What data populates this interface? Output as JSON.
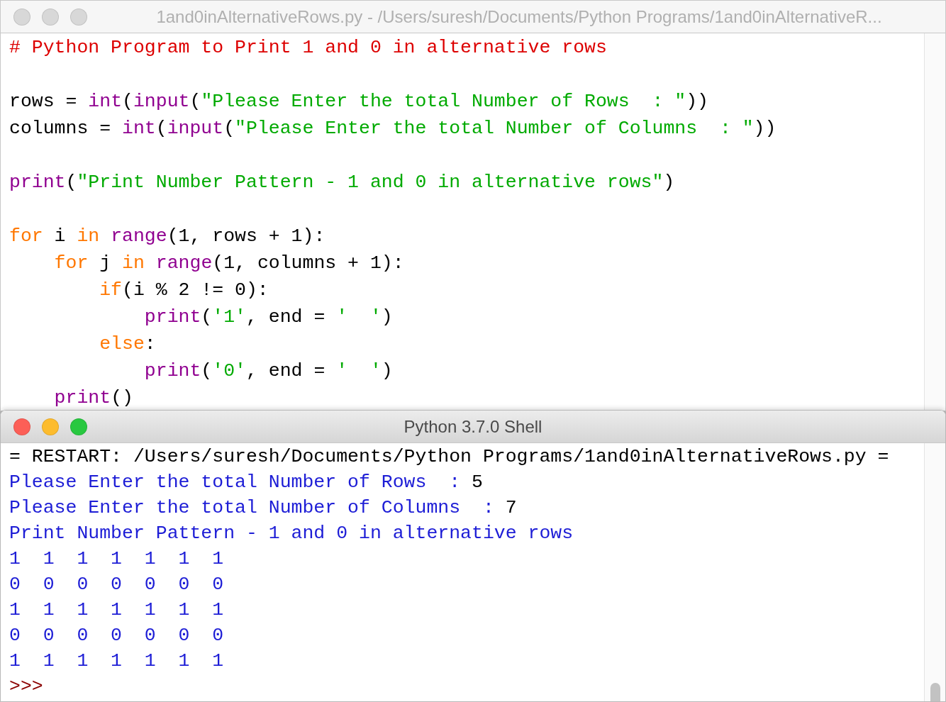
{
  "editor": {
    "title": "1and0inAlternativeRows.py - /Users/suresh/Documents/Python Programs/1and0inAlternativeR...",
    "active": false,
    "blocks": [
      {
        "lines": [
          {
            "tokens": [
              {
                "kind": "comment",
                "text": "# Python Program to Print 1 and 0 in alternative rows"
              }
            ]
          }
        ]
      },
      {
        "lines": [
          {
            "tokens": [
              {
                "kind": "plain",
                "text": "rows = "
              },
              {
                "kind": "builtin",
                "text": "int"
              },
              {
                "kind": "plain",
                "text": "("
              },
              {
                "kind": "builtin",
                "text": "input"
              },
              {
                "kind": "plain",
                "text": "("
              },
              {
                "kind": "string",
                "text": "\"Please Enter the total Number of Rows  : \""
              },
              {
                "kind": "plain",
                "text": "))"
              }
            ]
          },
          {
            "tokens": [
              {
                "kind": "plain",
                "text": "columns = "
              },
              {
                "kind": "builtin",
                "text": "int"
              },
              {
                "kind": "plain",
                "text": "("
              },
              {
                "kind": "builtin",
                "text": "input"
              },
              {
                "kind": "plain",
                "text": "("
              },
              {
                "kind": "string",
                "text": "\"Please Enter the total Number of Columns  : \""
              },
              {
                "kind": "plain",
                "text": "))"
              }
            ]
          }
        ]
      },
      {
        "lines": [
          {
            "tokens": [
              {
                "kind": "builtin",
                "text": "print"
              },
              {
                "kind": "plain",
                "text": "("
              },
              {
                "kind": "string",
                "text": "\"Print Number Pattern - 1 and 0 in alternative rows\""
              },
              {
                "kind": "plain",
                "text": ")"
              }
            ]
          }
        ]
      },
      {
        "lines": [
          {
            "tokens": [
              {
                "kind": "keyword",
                "text": "for"
              },
              {
                "kind": "plain",
                "text": " i "
              },
              {
                "kind": "keyword",
                "text": "in "
              },
              {
                "kind": "builtin",
                "text": "range"
              },
              {
                "kind": "plain",
                "text": "(1, rows + 1):"
              }
            ]
          },
          {
            "tokens": [
              {
                "kind": "keyword",
                "text": "    for"
              },
              {
                "kind": "plain",
                "text": " j "
              },
              {
                "kind": "keyword",
                "text": "in "
              },
              {
                "kind": "builtin",
                "text": "range"
              },
              {
                "kind": "plain",
                "text": "(1, columns + 1):"
              }
            ]
          },
          {
            "tokens": [
              {
                "kind": "keyword",
                "text": "        if"
              },
              {
                "kind": "plain",
                "text": "(i % 2 != 0):"
              }
            ]
          },
          {
            "tokens": [
              {
                "kind": "builtin",
                "text": "            print"
              },
              {
                "kind": "plain",
                "text": "("
              },
              {
                "kind": "string",
                "text": "'1'"
              },
              {
                "kind": "plain",
                "text": ", end = "
              },
              {
                "kind": "string",
                "text": "'  '"
              },
              {
                "kind": "plain",
                "text": ")"
              }
            ]
          },
          {
            "tokens": [
              {
                "kind": "keyword",
                "text": "        else"
              },
              {
                "kind": "plain",
                "text": ":"
              }
            ]
          },
          {
            "tokens": [
              {
                "kind": "builtin",
                "text": "            print"
              },
              {
                "kind": "plain",
                "text": "("
              },
              {
                "kind": "string",
                "text": "'0'"
              },
              {
                "kind": "plain",
                "text": ", end = "
              },
              {
                "kind": "string",
                "text": "'  '"
              },
              {
                "kind": "plain",
                "text": ")"
              }
            ]
          },
          {
            "tokens": [
              {
                "kind": "builtin",
                "text": "    print"
              },
              {
                "kind": "plain",
                "text": "()"
              }
            ]
          }
        ]
      }
    ]
  },
  "shell": {
    "title": "Python 3.7.0 Shell",
    "active": true,
    "lines": [
      {
        "kind": "plain",
        "text": "= RESTART: /Users/suresh/Documents/Python Programs/1and0inAlternativeRows.py ="
      },
      {
        "kind": "output",
        "text": "Please Enter the total Number of Rows  : ",
        "input": "5"
      },
      {
        "kind": "output",
        "text": "Please Enter the total Number of Columns  : ",
        "input": "7"
      },
      {
        "kind": "output",
        "text": "Print Number Pattern - 1 and 0 in alternative rows"
      },
      {
        "kind": "output",
        "text": "1  1  1  1  1  1  1"
      },
      {
        "kind": "output",
        "text": "0  0  0  0  0  0  0"
      },
      {
        "kind": "output",
        "text": "1  1  1  1  1  1  1"
      },
      {
        "kind": "output",
        "text": "0  0  0  0  0  0  0"
      },
      {
        "kind": "output",
        "text": "1  1  1  1  1  1  1"
      },
      {
        "kind": "prompt",
        "text": ">>>"
      }
    ]
  }
}
